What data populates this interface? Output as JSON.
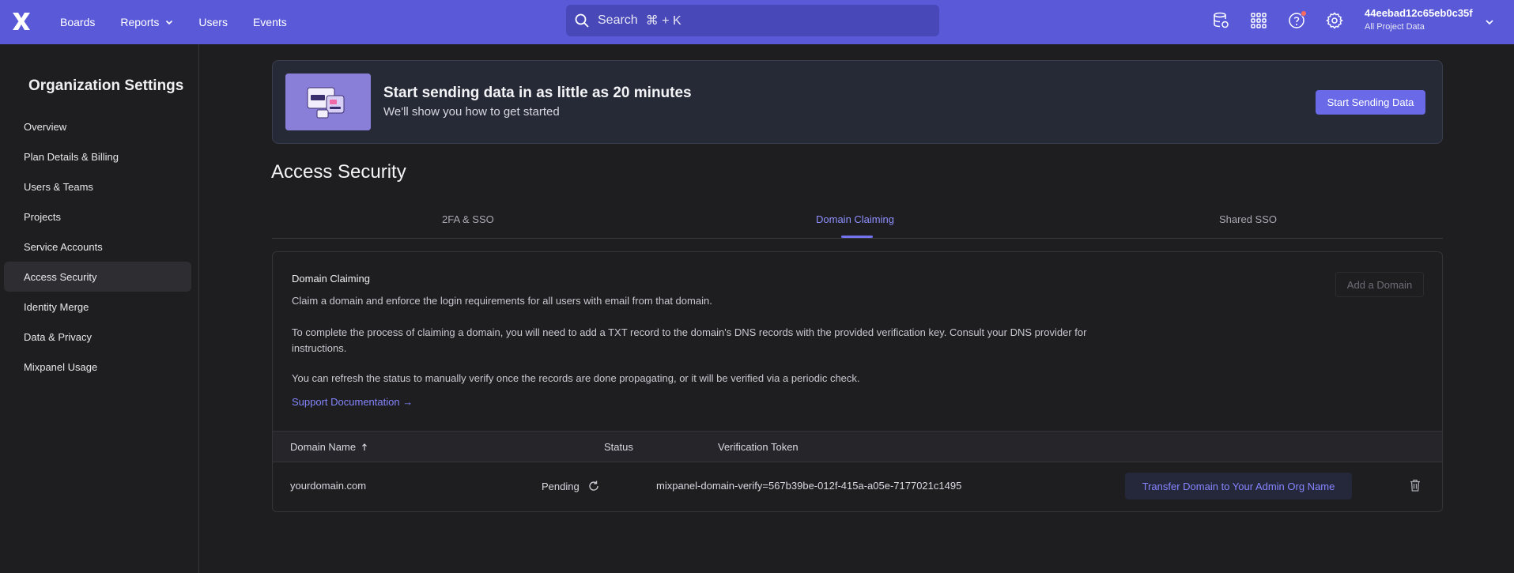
{
  "topbar": {
    "nav": {
      "boards": "Boards",
      "reports": "Reports",
      "users": "Users",
      "events": "Events"
    },
    "search_placeholder": "Search",
    "search_shortcut": "⌘ + K",
    "project_id": "44eebad12c65eb0c35f",
    "project_data": "All Project Data",
    "icons": [
      "data-icon",
      "apps-grid-icon",
      "help-icon",
      "gear-icon"
    ]
  },
  "sidebar": {
    "title": "Organization Settings",
    "items": [
      {
        "label": "Overview"
      },
      {
        "label": "Plan Details & Billing"
      },
      {
        "label": "Users & Teams"
      },
      {
        "label": "Projects"
      },
      {
        "label": "Service Accounts"
      },
      {
        "label": "Access Security"
      },
      {
        "label": "Identity Merge"
      },
      {
        "label": "Data & Privacy"
      },
      {
        "label": "Mixpanel Usage"
      }
    ],
    "active_item": "Access Security"
  },
  "banner": {
    "title": "Start sending data in as little as 20 minutes",
    "subtitle": "We'll show you how to get started",
    "button": "Start Sending Data"
  },
  "page": {
    "title": "Access Security",
    "tabs": [
      {
        "label": "2FA & SSO"
      },
      {
        "label": "Domain Claiming"
      },
      {
        "label": "Shared SSO"
      }
    ],
    "active_tab": "Domain Claiming"
  },
  "domain_claiming": {
    "title": "Domain Claiming",
    "add_button": "Add a Domain",
    "para1": "Claim a domain and enforce the login requirements for all users with email from that domain.",
    "para2": "To complete the process of claiming a domain, you will need to add a TXT record to the domain's DNS records with the provided verification key. Consult your DNS provider for instructions.",
    "para3": "You can refresh the status to manually verify once the records are done propagating, or it will be verified via a periodic check.",
    "support_link": "Support Documentation →",
    "table": {
      "headers": {
        "domain": "Domain Name",
        "status": "Status",
        "token": "Verification Token"
      },
      "rows": [
        {
          "domain": "yourdomain.com",
          "status": "Pending",
          "token": "mixpanel-domain-verify=567b39be-012f-415a-a05e-7177021c1495",
          "action": "Transfer Domain to Your Admin Org Name"
        }
      ]
    }
  },
  "colors": {
    "topbar": "#5a5ad9",
    "accent": "#7373f0",
    "background": "#1e1e20",
    "notification_dot": "#ff6b5b"
  }
}
